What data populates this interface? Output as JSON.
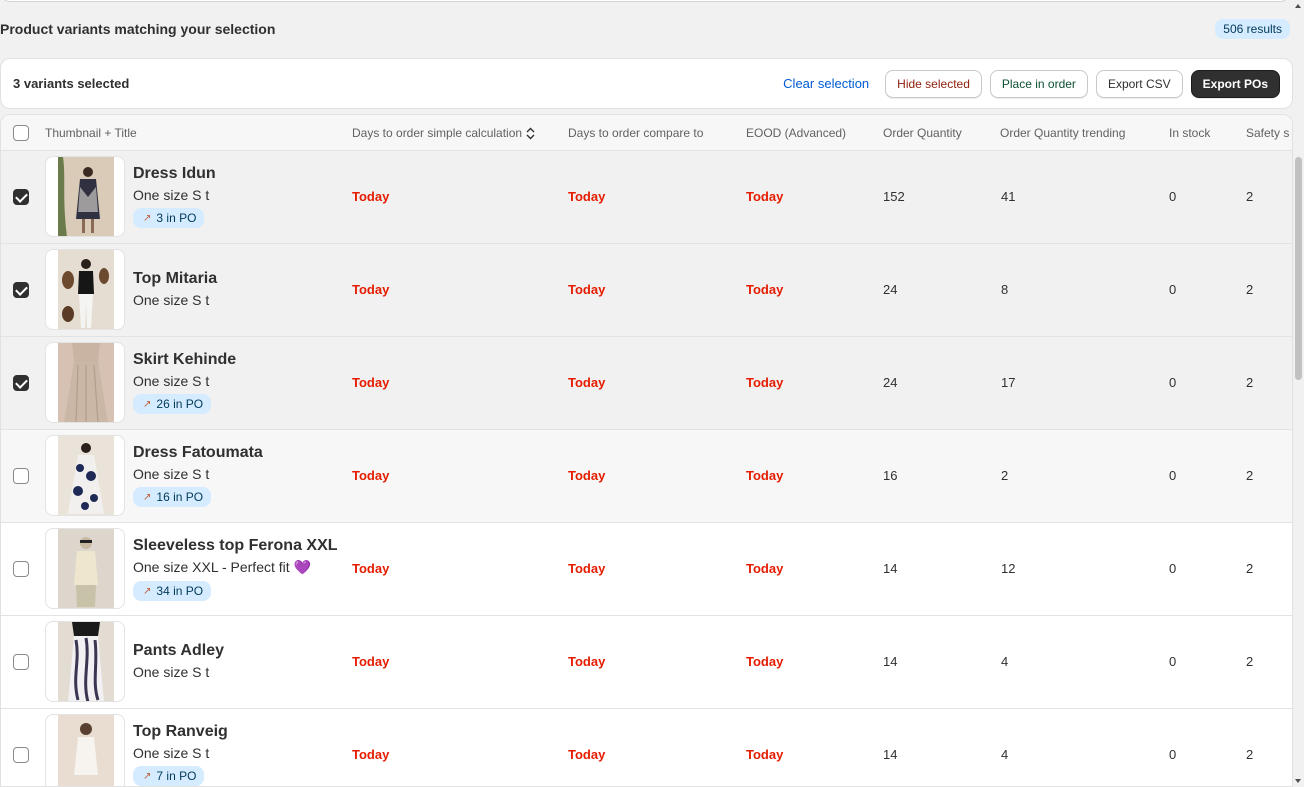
{
  "header": {
    "title": "Product variants matching your selection",
    "results_badge": "506 results"
  },
  "selection_bar": {
    "count_label": "3 variants selected",
    "clear_label": "Clear selection",
    "hide_label": "Hide selected",
    "place_label": "Place in order",
    "export_csv_label": "Export CSV",
    "export_pos_label": "Export POs"
  },
  "table": {
    "columns": [
      "Thumbnail + Title",
      "Days to order simple calculation",
      "Days to order compare to",
      "EOOD (Advanced)",
      "Order Quantity",
      "Order Quantity trending",
      "In stock",
      "Safety s"
    ],
    "rows": [
      {
        "title": "Dress Idun",
        "variant": "One size S t",
        "po": "3 in PO",
        "simple": "Today",
        "compare": "Today",
        "eood": "Today",
        "qty": "152",
        "trend": "41",
        "stock": "0",
        "safety": "2",
        "selected": true
      },
      {
        "title": "Top Mitaria",
        "variant": "One size S t",
        "po": "",
        "simple": "Today",
        "compare": "Today",
        "eood": "Today",
        "qty": "24",
        "trend": "8",
        "stock": "0",
        "safety": "2",
        "selected": true
      },
      {
        "title": "Skirt Kehinde",
        "variant": "One size S t",
        "po": "26 in PO",
        "simple": "Today",
        "compare": "Today",
        "eood": "Today",
        "qty": "24",
        "trend": "17",
        "stock": "0",
        "safety": "2",
        "selected": true
      },
      {
        "title": "Dress Fatoumata",
        "variant": "One size S t",
        "po": "16 in PO",
        "simple": "Today",
        "compare": "Today",
        "eood": "Today",
        "qty": "16",
        "trend": "2",
        "stock": "0",
        "safety": "2",
        "selected": false
      },
      {
        "title": "Sleeveless top Ferona XXL",
        "variant": "One size XXL - Perfect fit 💜",
        "po": "34 in PO",
        "simple": "Today",
        "compare": "Today",
        "eood": "Today",
        "qty": "14",
        "trend": "12",
        "stock": "0",
        "safety": "2",
        "selected": false
      },
      {
        "title": "Pants Adley",
        "variant": "One size S t",
        "po": "",
        "simple": "Today",
        "compare": "Today",
        "eood": "Today",
        "qty": "14",
        "trend": "4",
        "stock": "0",
        "safety": "2",
        "selected": false
      },
      {
        "title": "Top Ranveig",
        "variant": "One size S t",
        "po": "7 in PO",
        "simple": "Today",
        "compare": "Today",
        "eood": "Today",
        "qty": "14",
        "trend": "4",
        "stock": "0",
        "safety": "2",
        "selected": false
      }
    ]
  },
  "colors": {
    "today": "#e51c00",
    "badge_bg": "#d5ebff",
    "primary_btn": "#303030"
  },
  "icons": {
    "po_badge": "package-icon",
    "sort": "sort-icon"
  }
}
